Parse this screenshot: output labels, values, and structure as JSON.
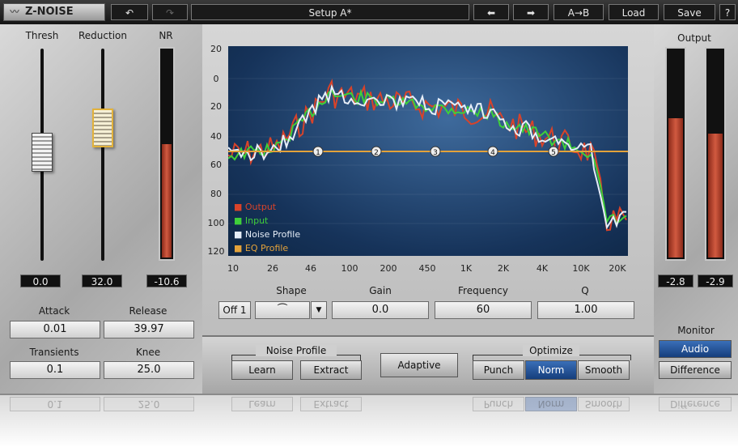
{
  "topbar": {
    "logo": "Z-NOISE",
    "undo_icon": "undo-icon",
    "redo_icon": "redo-icon",
    "setup_name": "Setup A*",
    "prev_icon": "arrow-left-icon",
    "next_icon": "arrow-right-icon",
    "ab_label": "A→B",
    "load_label": "Load",
    "save_label": "Save",
    "help_label": "?"
  },
  "left": {
    "thresh_label": "Thresh",
    "reduction_label": "Reduction",
    "nr_label": "NR",
    "thresh_value": "0.0",
    "reduction_value": "32.0",
    "nr_value": "-10.6",
    "nr_meter_level": 0.54,
    "attack_label": "Attack",
    "attack_value": "0.01",
    "release_label": "Release",
    "release_value": "39.97",
    "transients_label": "Transients",
    "transients_value": "0.1",
    "knee_label": "Knee",
    "knee_value": "25.0"
  },
  "graph": {
    "y_ticks": [
      "20",
      "0",
      "20",
      "40",
      "60",
      "80",
      "100",
      "120"
    ],
    "x_ticks": [
      "10",
      "26",
      "46",
      "100",
      "200",
      "450",
      "1K",
      "2K",
      "4K",
      "10K",
      "20K"
    ],
    "legend": [
      {
        "label": "Output",
        "color": "#d8432a"
      },
      {
        "label": "Input",
        "color": "#3fcf3a"
      },
      {
        "label": "Noise Profile",
        "color": "#e6eef8"
      },
      {
        "label": "EQ Profile",
        "color": "#e3a23a"
      }
    ],
    "eq_bands": [
      "1",
      "2",
      "3",
      "4",
      "5"
    ]
  },
  "eq": {
    "off_label": "Off 1",
    "shape_label": "Shape",
    "gain_label": "Gain",
    "gain_value": "0.0",
    "frequency_label": "Frequency",
    "frequency_value": "60",
    "q_label": "Q",
    "q_value": "1.00"
  },
  "bottom": {
    "noise_profile_label": "Noise Profile",
    "learn_label": "Learn",
    "extract_label": "Extract",
    "adaptive_label": "Adaptive",
    "optimize_label": "Optimize",
    "punch_label": "Punch",
    "norm_label": "Norm",
    "smooth_label": "Smooth"
  },
  "right": {
    "output_label": "Output",
    "left_value": "-2.8",
    "right_value": "-2.9",
    "left_meter_level": 0.66,
    "right_meter_level": 0.59,
    "monitor_label": "Monitor",
    "audio_label": "Audio",
    "difference_label": "Difference"
  },
  "reflection": {
    "transients_value": "0.1",
    "knee_value": "25.0",
    "learn_label": "Learn",
    "extract_label": "Extract",
    "punch_label": "Punch",
    "norm_label": "Norm",
    "smooth_label": "Smooth",
    "difference_label": "Difference"
  },
  "colors": {
    "accent_active": "#1e4f98",
    "meter_red": "#d15a40",
    "eq_line": "#e3a23a"
  }
}
